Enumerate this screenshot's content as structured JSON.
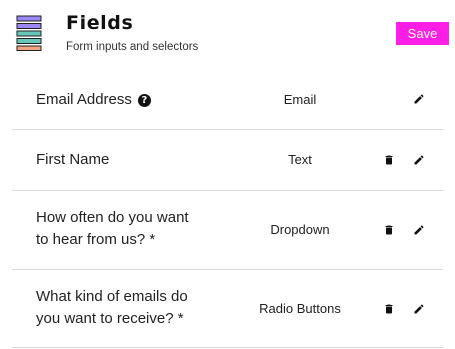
{
  "header": {
    "title": "Fields",
    "subtitle": "Form inputs and selectors",
    "save_label": "Save"
  },
  "colors": {
    "save_button": "#ff1ee6",
    "logo_bar_1": "#9b87f5",
    "logo_bar_2": "#66c7b8",
    "logo_bar_3": "#f2a57e"
  },
  "fields": [
    {
      "line1": "Email Address",
      "line2": "",
      "type": "Email",
      "has_help": true,
      "has_delete": false
    },
    {
      "line1": "First Name",
      "line2": "",
      "type": "Text",
      "has_help": false,
      "has_delete": true
    },
    {
      "line1": "How often do you want",
      "line2": "to hear from us? *",
      "type": "Dropdown",
      "has_help": false,
      "has_delete": true
    },
    {
      "line1": "What kind of emails do",
      "line2": "you want to receive? *",
      "type": "Radio Buttons",
      "has_help": false,
      "has_delete": true
    }
  ],
  "icons": {
    "logo": "form-list-logo-icon",
    "help": "help-circle-icon",
    "delete": "trash-icon",
    "edit": "pencil-icon"
  }
}
